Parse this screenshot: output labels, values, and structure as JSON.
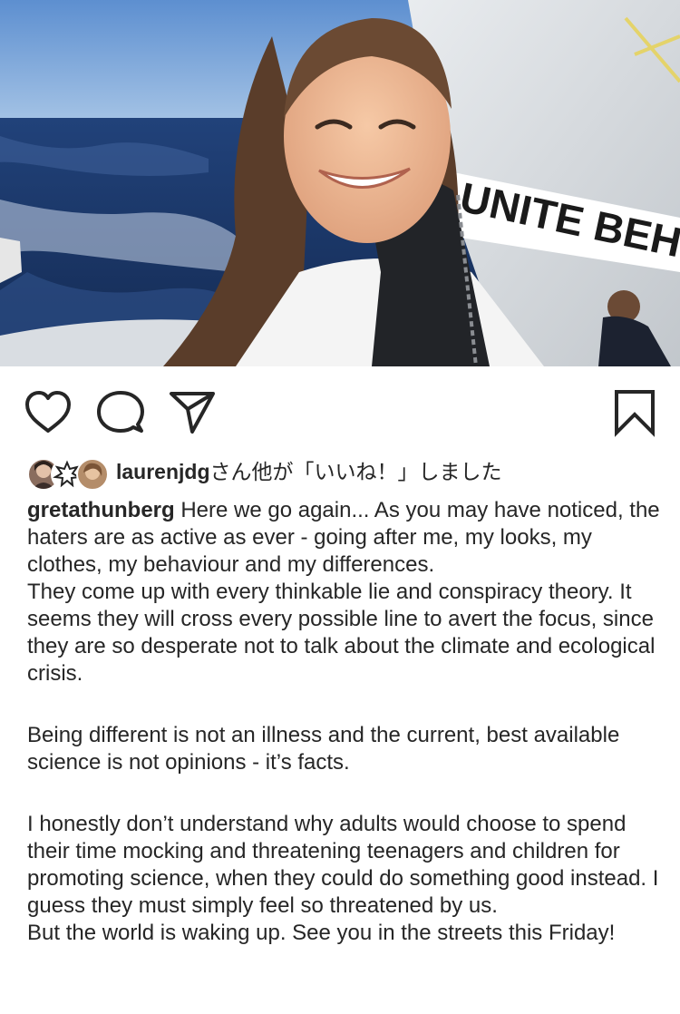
{
  "photo": {
    "alt": "Smiling girl with long hair in a white shirt and dark life vest on a sailboat at sea",
    "sail_text": "UNITE BEHI"
  },
  "actions": {
    "like_icon": "heart-icon",
    "comment_icon": "comment-bubble-icon",
    "share_icon": "paper-plane-icon",
    "save_icon": "bookmark-icon"
  },
  "likes": {
    "username": "laurenjdg",
    "suffix": "さん他が「いいね！」しました"
  },
  "caption": {
    "username": "gretathunberg",
    "first_line": " Here we go again... As you may have noticed, the haters are as active as ever - going after me, my looks, my clothes, my behaviour and my differences.",
    "p1": "They come up with every thinkable lie and conspiracy theory. It seems they will cross every possible line to avert the focus, since they are so desperate not to talk about the climate and ecological crisis.",
    "p2": "Being different is not an illness and the current, best available science is not opinions - it’s facts.",
    "p3": "I honestly don’t understand why adults would choose to spend their time mocking and threatening teenagers and children for promoting science, when they could do something good instead. I guess they must simply feel so threatened by us.",
    "p4": "But the world is waking up. See you in the streets this Friday!"
  },
  "colors": {
    "text": "#262626",
    "icon": "#262626",
    "background": "#ffffff"
  }
}
